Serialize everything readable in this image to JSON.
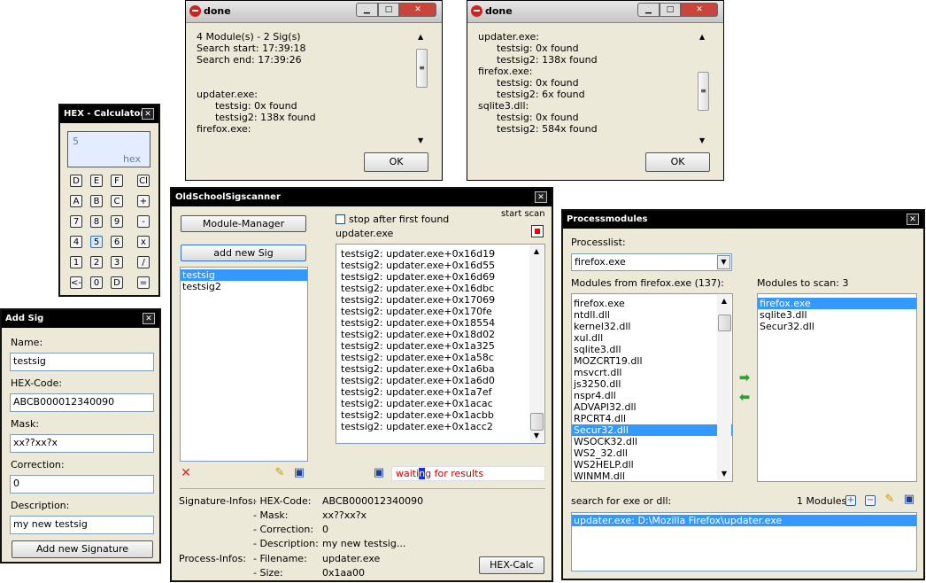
{
  "hexcalc": {
    "title": "HEX - Calculator",
    "close": "✕",
    "value": "5",
    "mode": "hex",
    "keys": [
      [
        "D",
        "E",
        "F",
        "Cl"
      ],
      [
        "A",
        "B",
        "C",
        "+"
      ],
      [
        "7",
        "8",
        "9",
        "-"
      ],
      [
        "4",
        "5",
        "6",
        "x"
      ],
      [
        "1",
        "2",
        "3",
        "/"
      ],
      [
        "<-",
        "0",
        "D",
        "="
      ]
    ]
  },
  "addsig": {
    "title": "Add Sig",
    "close": "✕",
    "name_label": "Name:",
    "name_value": "testsig",
    "hex_label": "HEX-Code:",
    "hex_value": "ABCB000012340090",
    "mask_label": "Mask:",
    "mask_value": "xx??xx?x",
    "corr_label": "Correction:",
    "corr_value": "0",
    "desc_label": "Description:",
    "desc_value": "my new testsig",
    "add_button": "Add new Signature"
  },
  "done1": {
    "title": "done",
    "lines": [
      "4 Module(s) - 2 Sig(s)",
      "Search start: 17:39:18",
      "Search end: 17:39:26",
      "",
      "",
      "updater.exe:",
      "      testsig: 0x found",
      "      testsig2: 138x found",
      "firefox.exe:"
    ],
    "ok": "OK"
  },
  "done2": {
    "title": "done",
    "lines": [
      "updater.exe:",
      "      testsig: 0x found",
      "      testsig2: 138x found",
      "firefox.exe:",
      "      testsig: 0x found",
      "      testsig2: 6x found",
      "sqlite3.dll:",
      "      testsig: 0x found",
      "      testsig2: 584x found"
    ],
    "ok": "OK"
  },
  "scanner": {
    "title": "OldSchoolSigscanner",
    "close": "✕",
    "module_manager": "Module-Manager",
    "add_new_sig": "add new Sig",
    "sigs": [
      "testsig",
      "testsig2"
    ],
    "stop_label": "stop after first found",
    "start_label": "start scan",
    "current_module": "updater.exe",
    "results": [
      "testsig2: updater.exe+0x16d19",
      "testsig2: updater.exe+0x16d55",
      "testsig2: updater.exe+0x16d69",
      "testsig2: updater.exe+0x16dbc",
      "testsig2: updater.exe+0x17069",
      "testsig2: updater.exe+0x170fe",
      "testsig2: updater.exe+0x18554",
      "testsig2: updater.exe+0x18d02",
      "testsig2: updater.exe+0x1a325",
      "testsig2: updater.exe+0x1a58c",
      "testsig2: updater.exe+0x1a6ba",
      "testsig2: updater.exe+0x1a6d0",
      "testsig2: updater.exe+0x1a7ef",
      "testsig2: updater.exe+0x1acac",
      "testsig2: updater.exe+0x1acbb",
      "testsig2: updater.exe+0x1acc2"
    ],
    "status_a": "waiti",
    "status_b": "n",
    "status_c": "g for results",
    "sig_infos_label": "Signature-Infos:",
    "hex_key": "- HEX-Code:",
    "hex_val": "ABCB000012340090",
    "mask_key": "- Mask:",
    "mask_val": "xx??xx?x",
    "corr_key": "- Correction:",
    "corr_val": "0",
    "desc_key": "- Description:",
    "desc_val": "my new testsig...",
    "proc_infos_label": "Process-Infos:",
    "file_key": "- Filename:",
    "file_val": "updater.exe",
    "size_key": "- Size:",
    "size_val": "0x1aa00",
    "hexcalc_button": "HEX-Calc",
    "status_color": "#cc0000"
  },
  "procmod": {
    "title": "Processmodules",
    "close": "✕",
    "processlist_label": "Processlist:",
    "process_value": "firefox.exe",
    "modules_from_label": "Modules from  firefox.exe (137):",
    "modules": [
      "firefox.exe",
      "ntdll.dll",
      "kernel32.dll",
      "xul.dll",
      "sqlite3.dll",
      "MOZCRT19.dll",
      "msvcrt.dll",
      "js3250.dll",
      "nspr4.dll",
      "ADVAPI32.dll",
      "RPCRT4.dll",
      "Secur32.dll",
      "WSOCK32.dll",
      "WS2_32.dll",
      "WS2HELP.dll",
      "WINMM.dll"
    ],
    "selected_module": 11,
    "to_scan_label": "Modules to scan: 3",
    "to_scan": [
      "firefox.exe",
      "sqlite3.dll",
      "Secur32.dll"
    ],
    "search_label": "search for exe or dll:",
    "count_label": "1 Modules",
    "search_result": "updater.exe: D:\\Mozilla Firefox\\updater.exe",
    "arrow_color": "#2aa52a"
  }
}
